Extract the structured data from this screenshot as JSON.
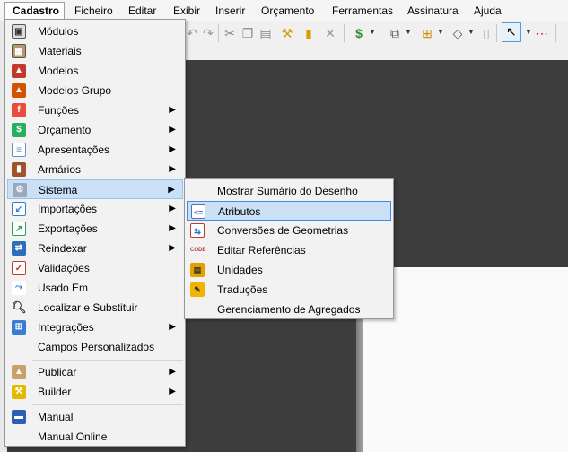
{
  "menubar": {
    "items": [
      "Cadastro",
      "Ficheiro",
      "Editar",
      "Exibir",
      "Inserir",
      "Orçamento",
      "Ferramentas",
      "Assinatura",
      "Ajuda"
    ]
  },
  "cadastro_menu": {
    "items": [
      {
        "label": "Módulos",
        "icon": "modules-icon",
        "submenu": false
      },
      {
        "label": "Materiais",
        "icon": "materials-icon",
        "submenu": false
      },
      {
        "label": "Modelos",
        "icon": "models-icon",
        "submenu": false
      },
      {
        "label": "Modelos Grupo",
        "icon": "model-group-icon",
        "submenu": false
      },
      {
        "label": "Funções",
        "icon": "functions-icon",
        "submenu": true
      },
      {
        "label": "Orçamento",
        "icon": "budget-icon",
        "submenu": true
      },
      {
        "label": "Apresentações",
        "icon": "presentations-icon",
        "submenu": true
      },
      {
        "label": "Armários",
        "icon": "cabinets-icon",
        "submenu": true
      },
      {
        "label": "Sistema",
        "icon": "system-icon",
        "submenu": true,
        "highlighted": true
      },
      {
        "label": "Importações",
        "icon": "import-icon",
        "submenu": true
      },
      {
        "label": "Exportações",
        "icon": "export-icon",
        "submenu": true
      },
      {
        "label": "Reindexar",
        "icon": "reindex-icon",
        "submenu": true
      },
      {
        "label": "Validações",
        "icon": "validations-icon",
        "submenu": false
      },
      {
        "label": "Usado Em",
        "icon": "used-in-icon",
        "submenu": false
      },
      {
        "label": "Localizar e Substituir",
        "icon": "search-icon",
        "submenu": false
      },
      {
        "label": "Integrações",
        "icon": "integrations-icon",
        "submenu": true
      },
      {
        "label": "Campos Personalizados",
        "icon": "",
        "submenu": false
      },
      {
        "label": "Publicar",
        "icon": "publish-icon",
        "submenu": true
      },
      {
        "label": "Builder",
        "icon": "builder-icon",
        "submenu": true
      },
      {
        "label": "Manual",
        "icon": "manual-icon",
        "submenu": false
      },
      {
        "label": "Manual Online",
        "icon": "",
        "submenu": false
      }
    ]
  },
  "sistema_submenu": {
    "items": [
      {
        "label": "Mostrar Sumário do Desenho",
        "icon": ""
      },
      {
        "label": "Atributos",
        "icon": "attributes-icon",
        "highlighted": true
      },
      {
        "label": "Conversões de Geometrias",
        "icon": "geometry-conversion-icon"
      },
      {
        "label": "Editar Referências",
        "icon": "code-references-icon",
        "icon_text": "CODE"
      },
      {
        "label": "Unidades",
        "icon": "units-icon"
      },
      {
        "label": "Traduções",
        "icon": "translations-icon"
      },
      {
        "label": "Gerenciamento de Agregados",
        "icon": ""
      }
    ]
  },
  "colors": {
    "highlight": "#c9e0f7",
    "highlight_border": "#3d8ee0",
    "canvas": "#3d3d3d"
  }
}
